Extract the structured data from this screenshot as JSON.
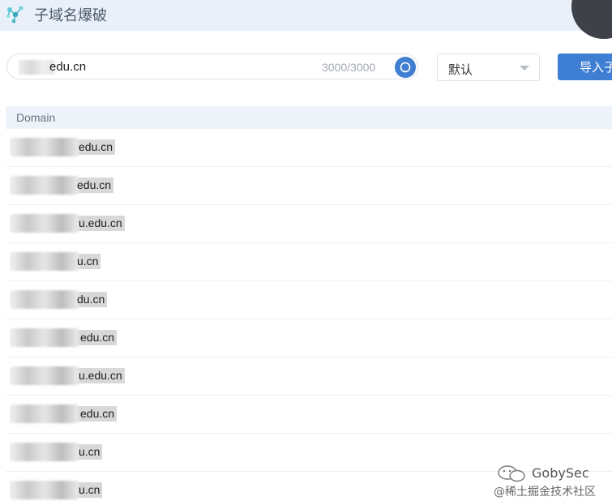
{
  "header": {
    "title": "子域名爆破",
    "icon": "molecule-logo-icon"
  },
  "search": {
    "value": "edu.cn",
    "count": "3000/3000",
    "button_icon": "search-icon"
  },
  "select": {
    "value": "默认",
    "caret_icon": "chevron-down-icon"
  },
  "import_button": {
    "label": "导入子"
  },
  "table": {
    "column_header": "Domain",
    "rows": [
      {
        "suffix": "edu.cn"
      },
      {
        "suffix": "edu.cn"
      },
      {
        "suffix": "u.edu.cn"
      },
      {
        "suffix": "u.cn"
      },
      {
        "suffix": "du.cn"
      },
      {
        "suffix": "edu.cn"
      },
      {
        "suffix": "u.edu.cn"
      },
      {
        "suffix": "edu.cn"
      },
      {
        "suffix": "u.cn"
      },
      {
        "suffix": "u.cn"
      }
    ]
  },
  "watermark": {
    "name": "GobySec",
    "sub": "@稀土掘金技术社区",
    "icon": "wechat-icon"
  },
  "colors": {
    "accent": "#3e7fd3",
    "header_bg": "#e9f0fa",
    "table_header_bg": "#eef3fa"
  }
}
